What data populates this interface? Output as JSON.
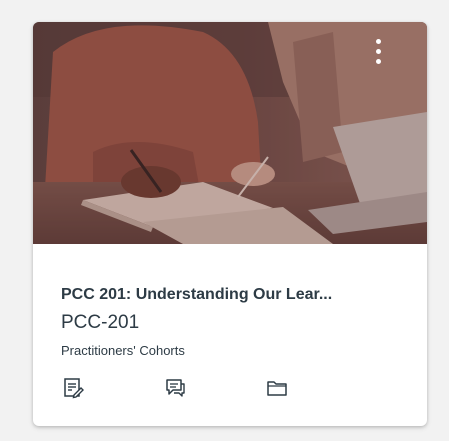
{
  "card": {
    "title": "PCC 201: Understanding Our Lear...",
    "code": "PCC-201",
    "term": "Practitioners' Cohorts",
    "hero_color": "#6f3d3a",
    "menu_icon": "kebab-menu-icon",
    "actions": [
      {
        "icon": "assignments-icon"
      },
      {
        "icon": "discussions-icon"
      },
      {
        "icon": "files-icon"
      }
    ]
  }
}
